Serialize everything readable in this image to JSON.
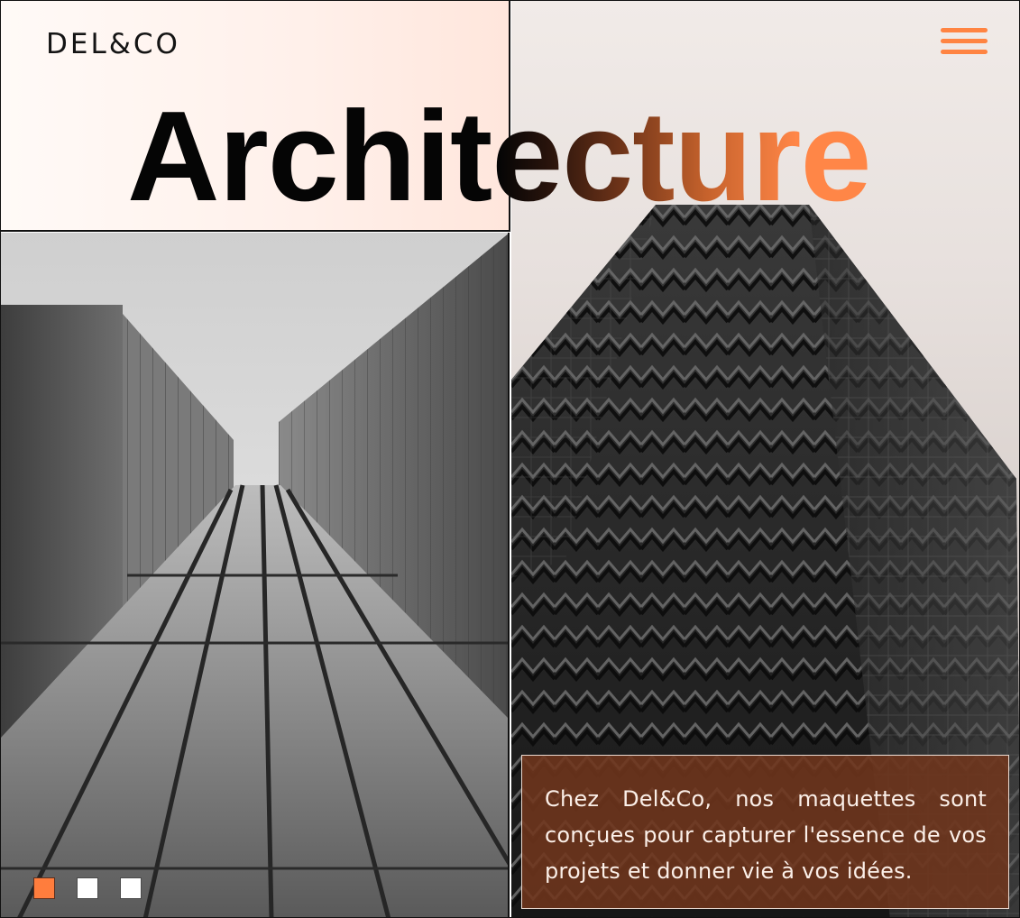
{
  "header": {
    "logo": "DEL&CO",
    "menu_icon": "hamburger-menu-icon"
  },
  "hero": {
    "title": "Architecture"
  },
  "images": {
    "left": "glass-facade-photo",
    "right": "zigzag-tower-photo"
  },
  "card": {
    "text": "Chez Del&Co, nos maquettes sont conçues pour capturer l'essence de vos projets et donner vie à vos idées."
  },
  "slider": {
    "count": 3,
    "active_index": 0
  },
  "colors": {
    "accent": "#ff8442",
    "card_bg": "#70361c",
    "dark": "#050505"
  }
}
